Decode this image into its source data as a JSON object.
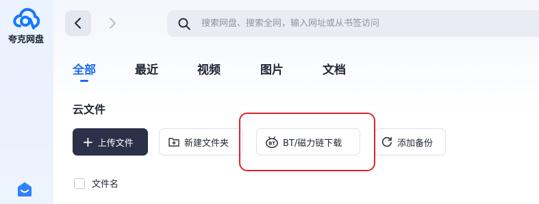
{
  "app": {
    "name": "夸克网盘"
  },
  "search": {
    "placeholder": "搜索网盘、搜索全网，输入网址或从书签访问"
  },
  "tabs": [
    {
      "label": "全部",
      "active": true
    },
    {
      "label": "最近"
    },
    {
      "label": "视频"
    },
    {
      "label": "图片"
    },
    {
      "label": "文档"
    }
  ],
  "section": {
    "title": "云文件"
  },
  "toolbar": {
    "upload_label": "上传文件",
    "new_folder_label": "新建文件夹",
    "bt_label": "BT/磁力链下载",
    "backup_label": "添加备份"
  },
  "table": {
    "name_header": "文件名"
  },
  "colors": {
    "accent": "#1f6cf0",
    "dark_button": "#2a3149",
    "highlight": "#e0202a"
  },
  "icons": [
    "cloud-logo-icon",
    "home-icon",
    "back-arrow-icon",
    "forward-arrow-icon",
    "search-icon",
    "plus-icon",
    "new-folder-icon",
    "bt-icon",
    "backup-sync-icon"
  ]
}
